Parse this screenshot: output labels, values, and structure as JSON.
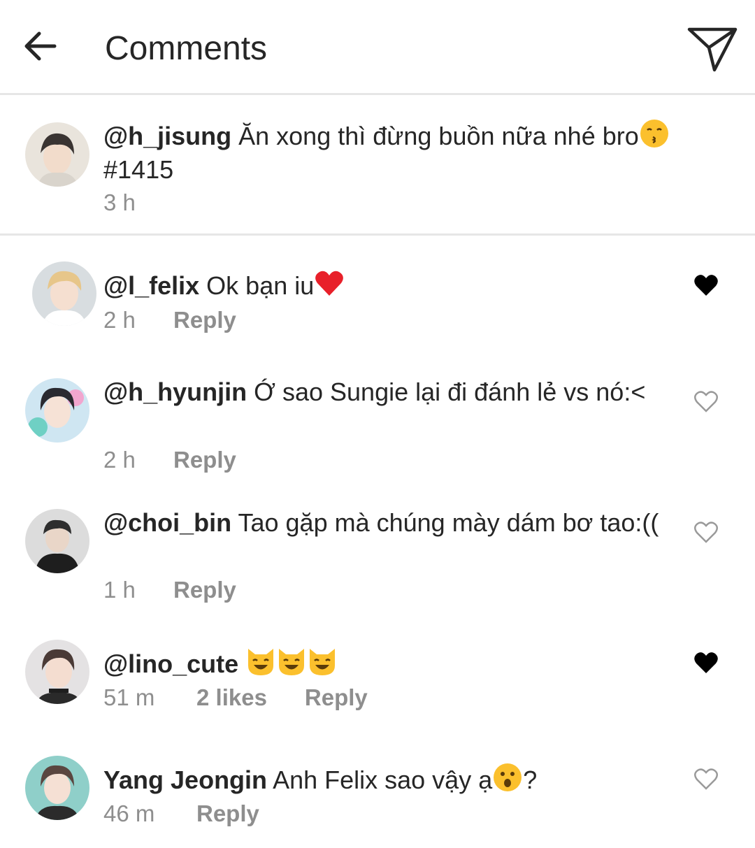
{
  "header": {
    "title": "Comments",
    "back_icon": "arrow-left-icon",
    "share_icon": "paper-plane-icon"
  },
  "caption": {
    "username": "@h_jisung",
    "text": " Ăn xong thì đừng buồn nữa nhé bro",
    "emoji": "kissing-face-emoji",
    "hashtag": "#1415",
    "time": "3 h"
  },
  "comments": [
    {
      "username": "@l_felix",
      "text": " Ok bạn iu",
      "emoji": "red-heart-emoji",
      "time": "2 h",
      "likes": "",
      "reply": "Reply",
      "liked": true
    },
    {
      "username": "@h_hyunjin",
      "text": " Ớ sao Sungie lại đi đánh lẻ vs nó:<",
      "time": "2 h",
      "likes": "",
      "reply": "Reply",
      "liked": false
    },
    {
      "username": "@choi_bin",
      "text": " Tao gặp mà chúng mày dám bơ tao:((",
      "time": "1 h",
      "likes": "",
      "reply": "Reply",
      "liked": false
    },
    {
      "username": "@lino_cute",
      "text": " ",
      "emoji": "grinning-cat-emoji",
      "time": "51 m",
      "likes": "2 likes",
      "reply": "Reply",
      "liked": true
    },
    {
      "username": "Yang Jeongin",
      "text": " Anh Felix sao vậy ạ",
      "emoji": "hushed-face-emoji",
      "text_after": "?",
      "time": "46 m",
      "likes": "",
      "reply": "Reply",
      "liked": false
    }
  ],
  "colors": {
    "text": "#262626",
    "meta": "#8e8e8e",
    "divider": "#e6e6e6",
    "heart_red": "#e8202a"
  }
}
